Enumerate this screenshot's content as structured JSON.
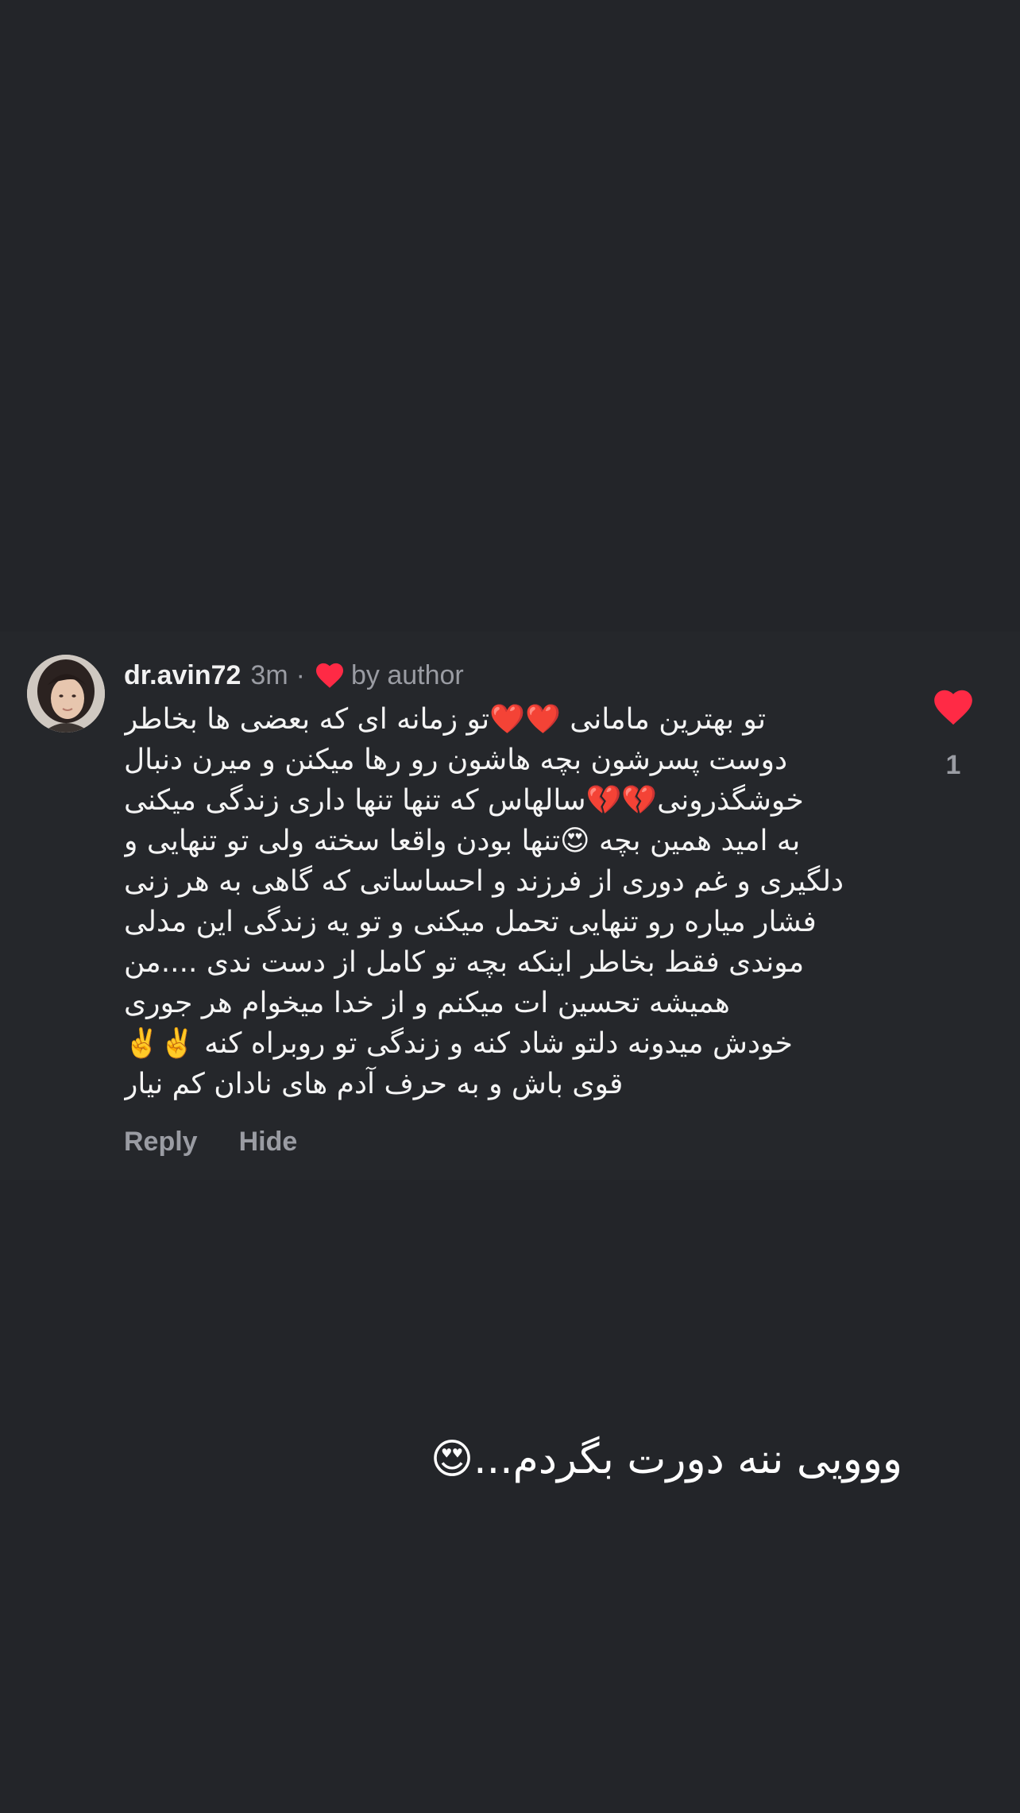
{
  "comment": {
    "username": "dr.avin72",
    "timestamp": "3m",
    "separator": "·",
    "author_badge": "by author",
    "lines": [
      "تو بهترین مامانی ❤️❤️تو زمانه ای که بعضی ها بخاطر",
      "دوست پسرشون بچه هاشون رو رها میکنن و میرن دنبال",
      "خوشگذرونی💔💔سالهاس که تنها تنها داری زندگی میکنی",
      "به امید همین بچه 😍تنها بودن واقعا سخته ولی تو تنهایی و",
      "دلگیری و غم دوری از فرزند و احساساتی که گاهی به هر زنی",
      "فشار میاره رو تنهایی تحمل میکنی و تو یه زندگی این مدلی",
      "موندی فقط بخاطر اینکه بچه تو کامل از دست ندی ....من",
      "همیشه تحسین ات میکنم و از خدا میخوام هر جوری",
      "خودش میدونه دلتو شاد کنه و زندگی تو روبراه کنه ✌️✌️",
      "قوی باش و به حرف آدم های نادان کم نیار"
    ],
    "reply_label": "Reply",
    "hide_label": "Hide",
    "like_count": "1",
    "heart_color": "#ff2a45"
  },
  "caption": "ووویی ننه دورت بگردم...😍",
  "icons": {
    "author_heart": "heart-icon",
    "like": "heart-filled-icon"
  }
}
